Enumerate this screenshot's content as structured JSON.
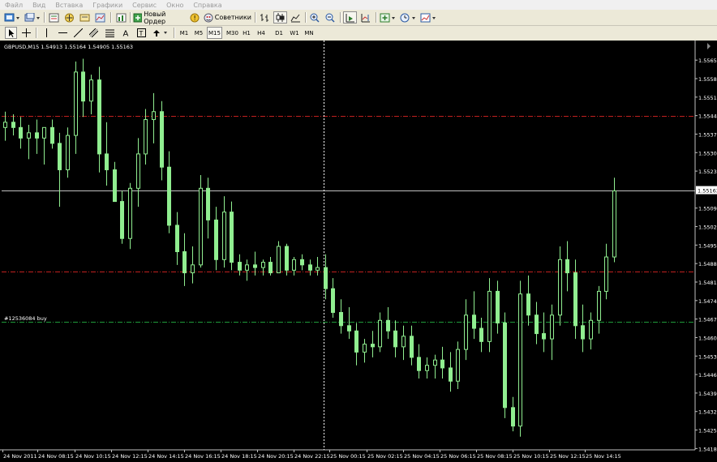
{
  "menu": [
    "Файл",
    "Вид",
    "Вставка",
    "Графики",
    "Сервис",
    "Окно",
    "Справка"
  ],
  "toolbar": {
    "new_order_label": "Новый Ордер",
    "advisors_label": "Советники"
  },
  "timeframes": [
    "M1",
    "M5",
    "M15",
    "M30",
    "H1",
    "H4",
    "D1",
    "W1",
    "MN"
  ],
  "active_timeframe": "M15",
  "chart": {
    "info_label": "GBPUSD,M15  1.54913 1.55164 1.54905 1.55163",
    "order_label": "#12536084 buy",
    "current_price": "1.55163",
    "price_ticks": [
      "1.55655",
      "1.55585",
      "1.55515",
      "1.55445",
      "1.55375",
      "1.55305",
      "1.55235",
      "1.55095",
      "1.55025",
      "1.54955",
      "1.54885",
      "1.54815",
      "1.54745",
      "1.54675",
      "1.54605",
      "1.54535",
      "1.54465",
      "1.54395",
      "1.54325",
      "1.54255",
      "1.54185"
    ],
    "time_ticks": [
      "24 Nov 2011",
      "24 Nov 08:15",
      "24 Nov 10:15",
      "24 Nov 12:15",
      "24 Nov 14:15",
      "24 Nov 16:15",
      "24 Nov 18:15",
      "24 Nov 20:15",
      "24 Nov 22:15",
      "25 Nov 00:15",
      "25 Nov 02:15",
      "25 Nov 04:15",
      "25 Nov 06:15",
      "25 Nov 08:15",
      "25 Nov 10:15",
      "25 Nov 12:15",
      "25 Nov 14:15"
    ],
    "levels": [
      {
        "name": "red-level-upper",
        "price": 1.55445,
        "color": "#c0201f",
        "style": "dash-dot"
      },
      {
        "name": "red-level-lower",
        "price": 1.54855,
        "color": "#c0201f",
        "style": "dash-dot"
      },
      {
        "name": "buy-order-level",
        "price": 1.54665,
        "color": "#1f9a3a",
        "style": "dash-dot"
      },
      {
        "name": "current-price-line",
        "price": 1.55163,
        "color": "#c0c0c0",
        "style": "solid"
      }
    ],
    "colors": {
      "background": "#000000",
      "candle_up": "#000000",
      "candle_down": "#90ee90",
      "candle_outline": "#90ee90",
      "text": "#ffffff",
      "grid_marker": "#c0c0c0"
    }
  },
  "chart_data": {
    "type": "candlestick",
    "symbol": "GBPUSD",
    "timeframe": "M15",
    "ylim": [
      1.5418,
      1.5572
    ],
    "candles": [
      [
        1.554,
        1.5546,
        1.5535,
        1.5542
      ],
      [
        1.5542,
        1.5545,
        1.5537,
        1.554
      ],
      [
        1.554,
        1.5544,
        1.5532,
        1.5536
      ],
      [
        1.5536,
        1.5541,
        1.5528,
        1.5538
      ],
      [
        1.5538,
        1.5543,
        1.553,
        1.5536
      ],
      [
        1.5536,
        1.554,
        1.5526,
        1.554
      ],
      [
        1.554,
        1.5543,
        1.5532,
        1.5534
      ],
      [
        1.5534,
        1.5538,
        1.551,
        1.5524
      ],
      [
        1.5524,
        1.554,
        1.5521,
        1.5537
      ],
      [
        1.5537,
        1.5565,
        1.553,
        1.5561
      ],
      [
        1.5561,
        1.5566,
        1.5544,
        1.555
      ],
      [
        1.555,
        1.556,
        1.5545,
        1.5558
      ],
      [
        1.5558,
        1.5563,
        1.5523,
        1.553
      ],
      [
        1.553,
        1.5542,
        1.5518,
        1.5524
      ],
      [
        1.5524,
        1.5527,
        1.5513,
        1.5512
      ],
      [
        1.5512,
        1.5516,
        1.5496,
        1.5498
      ],
      [
        1.5498,
        1.5519,
        1.5494,
        1.5517
      ],
      [
        1.5517,
        1.5536,
        1.551,
        1.553
      ],
      [
        1.553,
        1.5547,
        1.5526,
        1.5543
      ],
      [
        1.5543,
        1.5553,
        1.5534,
        1.5546
      ],
      [
        1.5546,
        1.555,
        1.552,
        1.5525
      ],
      [
        1.5525,
        1.5531,
        1.55,
        1.5503
      ],
      [
        1.5503,
        1.5508,
        1.5488,
        1.5493
      ],
      [
        1.5493,
        1.55,
        1.548,
        1.5485
      ],
      [
        1.5485,
        1.5495,
        1.5481,
        1.5488
      ],
      [
        1.5488,
        1.5522,
        1.5487,
        1.5517
      ],
      [
        1.5517,
        1.5521,
        1.5498,
        1.5505
      ],
      [
        1.5505,
        1.551,
        1.5486,
        1.549
      ],
      [
        1.549,
        1.5514,
        1.5487,
        1.5508
      ],
      [
        1.5508,
        1.5512,
        1.5486,
        1.5489
      ],
      [
        1.5489,
        1.5492,
        1.5484,
        1.5486
      ],
      [
        1.5486,
        1.549,
        1.5482,
        1.5488
      ],
      [
        1.5488,
        1.5493,
        1.5484,
        1.5487
      ],
      [
        1.5487,
        1.549,
        1.5484,
        1.5489
      ],
      [
        1.5489,
        1.5491,
        1.5484,
        1.5485
      ],
      [
        1.5485,
        1.5497,
        1.5485,
        1.5495
      ],
      [
        1.5495,
        1.5496,
        1.5484,
        1.5486
      ],
      [
        1.5486,
        1.5491,
        1.5484,
        1.549
      ],
      [
        1.549,
        1.5492,
        1.5486,
        1.5488
      ],
      [
        1.5488,
        1.549,
        1.5484,
        1.5486
      ],
      [
        1.5486,
        1.5491,
        1.5484,
        1.5487
      ],
      [
        1.5487,
        1.5492,
        1.5475,
        1.5479
      ],
      [
        1.5479,
        1.5483,
        1.5468,
        1.547
      ],
      [
        1.547,
        1.5475,
        1.5462,
        1.5465
      ],
      [
        1.5465,
        1.5472,
        1.546,
        1.5463
      ],
      [
        1.5463,
        1.5466,
        1.545,
        1.5455
      ],
      [
        1.5455,
        1.546,
        1.5451,
        1.5458
      ],
      [
        1.5458,
        1.5463,
        1.5453,
        1.5457
      ],
      [
        1.5457,
        1.547,
        1.5455,
        1.5467
      ],
      [
        1.5467,
        1.5472,
        1.546,
        1.5463
      ],
      [
        1.5463,
        1.5467,
        1.5453,
        1.5457
      ],
      [
        1.5457,
        1.5465,
        1.5452,
        1.5461
      ],
      [
        1.5461,
        1.5465,
        1.545,
        1.5453
      ],
      [
        1.5453,
        1.5458,
        1.5445,
        1.5448
      ],
      [
        1.5448,
        1.5453,
        1.5445,
        1.545
      ],
      [
        1.545,
        1.5454,
        1.5445,
        1.5452
      ],
      [
        1.5452,
        1.5457,
        1.5445,
        1.5449
      ],
      [
        1.5449,
        1.5455,
        1.544,
        1.5444
      ],
      [
        1.5444,
        1.5459,
        1.5441,
        1.5456
      ],
      [
        1.5456,
        1.5475,
        1.5452,
        1.5469
      ],
      [
        1.5469,
        1.5478,
        1.546,
        1.5464
      ],
      [
        1.5464,
        1.5468,
        1.5455,
        1.5459
      ],
      [
        1.5459,
        1.5483,
        1.5455,
        1.5478
      ],
      [
        1.5478,
        1.5482,
        1.5462,
        1.5466
      ],
      [
        1.5466,
        1.547,
        1.543,
        1.5434
      ],
      [
        1.5434,
        1.5438,
        1.5425,
        1.5427
      ],
      [
        1.5427,
        1.5482,
        1.5423,
        1.5477
      ],
      [
        1.5477,
        1.5484,
        1.5465,
        1.5469
      ],
      [
        1.5469,
        1.5474,
        1.5458,
        1.5462
      ],
      [
        1.5462,
        1.547,
        1.5455,
        1.546
      ],
      [
        1.546,
        1.5473,
        1.5452,
        1.5469
      ],
      [
        1.5469,
        1.5495,
        1.5465,
        1.549
      ],
      [
        1.549,
        1.5497,
        1.5478,
        1.5485
      ],
      [
        1.5485,
        1.549,
        1.546,
        1.5465
      ],
      [
        1.5465,
        1.5473,
        1.5455,
        1.546
      ],
      [
        1.546,
        1.547,
        1.5456,
        1.5467
      ],
      [
        1.5467,
        1.548,
        1.5462,
        1.5478
      ],
      [
        1.5478,
        1.5496,
        1.5475,
        1.5491
      ],
      [
        1.5491,
        1.5521,
        1.5489,
        1.5516
      ]
    ]
  }
}
